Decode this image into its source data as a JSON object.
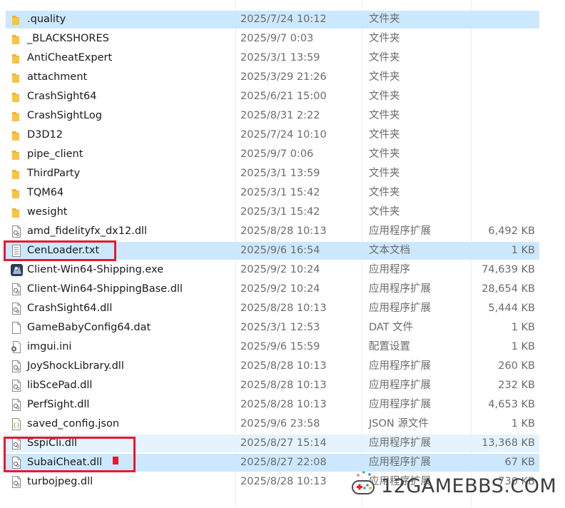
{
  "files": [
    {
      "name": ".quality",
      "date": "2025/7/24 10:12",
      "type": "文件夹",
      "size": "",
      "icon": "folder-icon",
      "state": "selected"
    },
    {
      "name": "_BLACKSHORES",
      "date": "2025/9/7 0:03",
      "type": "文件夹",
      "size": "",
      "icon": "folder-icon"
    },
    {
      "name": "AntiCheatExpert",
      "date": "2025/3/1 13:59",
      "type": "文件夹",
      "size": "",
      "icon": "folder-icon"
    },
    {
      "name": "attachment",
      "date": "2025/3/29 21:26",
      "type": "文件夹",
      "size": "",
      "icon": "folder-icon"
    },
    {
      "name": "CrashSight64",
      "date": "2025/6/21 15:00",
      "type": "文件夹",
      "size": "",
      "icon": "folder-icon"
    },
    {
      "name": "CrashSightLog",
      "date": "2025/8/31 2:22",
      "type": "文件夹",
      "size": "",
      "icon": "folder-icon"
    },
    {
      "name": "D3D12",
      "date": "2025/7/24 10:10",
      "type": "文件夹",
      "size": "",
      "icon": "folder-icon"
    },
    {
      "name": "pipe_client",
      "date": "2025/9/7 0:06",
      "type": "文件夹",
      "size": "",
      "icon": "folder-icon"
    },
    {
      "name": "ThirdParty",
      "date": "2025/3/1 13:59",
      "type": "文件夹",
      "size": "",
      "icon": "folder-icon"
    },
    {
      "name": "TQM64",
      "date": "2025/3/1 15:42",
      "type": "文件夹",
      "size": "",
      "icon": "folder-icon"
    },
    {
      "name": "wesight",
      "date": "2025/3/1 15:42",
      "type": "文件夹",
      "size": "",
      "icon": "folder-icon"
    },
    {
      "name": "amd_fidelityfx_dx12.dll",
      "date": "2025/8/28 10:13",
      "type": "应用程序扩展",
      "size": "6,492 KB",
      "icon": "dll-file-icon"
    },
    {
      "name": "CenLoader.txt",
      "date": "2025/9/6 16:54",
      "type": "文本文档",
      "size": "1 KB",
      "icon": "text-file-icon",
      "state": "selected"
    },
    {
      "name": "Client-Win64-Shipping.exe",
      "date": "2025/9/2 10:24",
      "type": "应用程序",
      "size": "74,639 KB",
      "icon": "exe-app-icon"
    },
    {
      "name": "Client-Win64-ShippingBase.dll",
      "date": "2025/9/2 10:24",
      "type": "应用程序扩展",
      "size": "28,654 KB",
      "icon": "dll-file-icon"
    },
    {
      "name": "CrashSight64.dll",
      "date": "2025/8/28 10:13",
      "type": "应用程序扩展",
      "size": "5,444 KB",
      "icon": "dll-file-icon"
    },
    {
      "name": "GameBabyConfig64.dat",
      "date": "2025/3/1 12:53",
      "type": "DAT 文件",
      "size": "1 KB",
      "icon": "blank-file-icon"
    },
    {
      "name": "imgui.ini",
      "date": "2025/9/6 15:59",
      "type": "配置设置",
      "size": "1 KB",
      "icon": "ini-file-icon"
    },
    {
      "name": "JoyShockLibrary.dll",
      "date": "2025/8/28 10:13",
      "type": "应用程序扩展",
      "size": "260 KB",
      "icon": "dll-file-icon"
    },
    {
      "name": "libScePad.dll",
      "date": "2025/8/28 10:13",
      "type": "应用程序扩展",
      "size": "232 KB",
      "icon": "dll-file-icon"
    },
    {
      "name": "PerfSight.dll",
      "date": "2025/8/28 10:13",
      "type": "应用程序扩展",
      "size": "4,653 KB",
      "icon": "dll-file-icon"
    },
    {
      "name": "saved_config.json",
      "date": "2025/9/6 23:58",
      "type": "JSON 源文件",
      "size": "1 KB",
      "icon": "json-file-icon"
    },
    {
      "name": "SspiCli.dll",
      "date": "2025/8/27 15:14",
      "type": "应用程序扩展",
      "size": "13,368 KB",
      "icon": "dll-file-icon",
      "state": "hover"
    },
    {
      "name": "SubaiCheat.dll",
      "date": "2025/8/27 22:08",
      "type": "应用程序扩展",
      "size": "67 KB",
      "icon": "dll-file-icon",
      "state": "selected"
    },
    {
      "name": "turbojpeg.dll",
      "date": "2025/8/28 10:13",
      "type": "应用程序扩展",
      "size": "730 KB",
      "icon": "dll-file-icon"
    }
  ],
  "colors": {
    "selected_bg": "#cce8ff",
    "hover_bg": "#e5f3ff",
    "highlight_red": "#e8182e",
    "folder_yellow": "#f8c441"
  },
  "watermark": {
    "text": "12GAMEBBS.COM"
  }
}
